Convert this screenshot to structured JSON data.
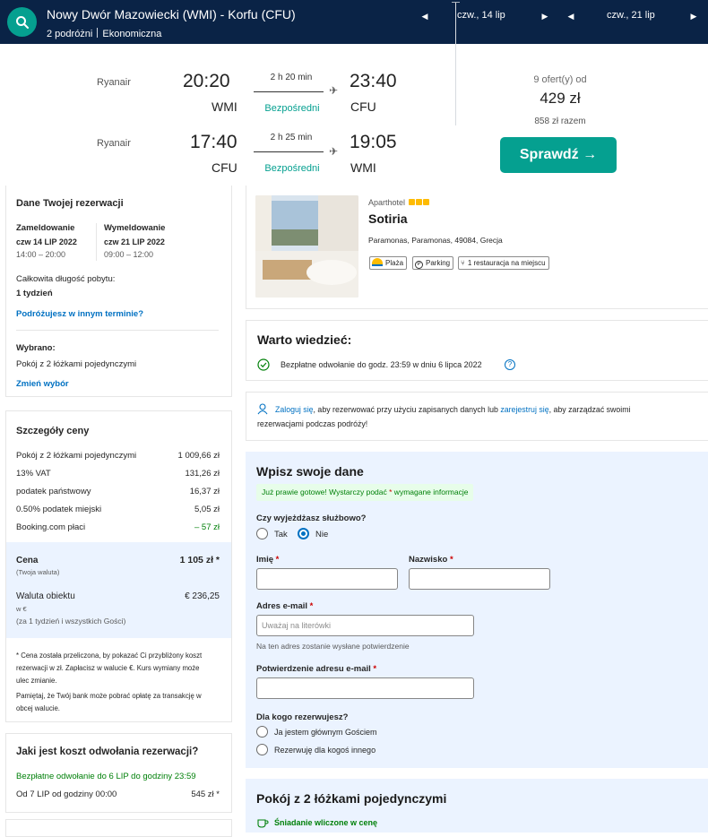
{
  "topbar": {
    "route": "Nowy Dwór Mazowiecki (WMI) - Korfu (CFU)",
    "travellers": "2 podróżni",
    "cabin": "Ekonomiczna",
    "depart_date": "czw., 14 lip",
    "return_date": "czw., 21 lip",
    "search_icon": "search-icon",
    "bg_color": "#0a2346",
    "accent": "#05a090"
  },
  "flight": {
    "outbound": {
      "airline": "Ryanair",
      "dep_time": "20:20",
      "dep_airport": "WMI",
      "duration": "2 h 20 min",
      "stops": "Bezpośredni",
      "arr_time": "23:40",
      "arr_airport": "CFU"
    },
    "inbound": {
      "airline": "Ryanair",
      "dep_time": "17:40",
      "dep_airport": "CFU",
      "duration": "2 h 25 min",
      "stops": "Bezpośredni",
      "arr_time": "19:05",
      "arr_airport": "WMI"
    },
    "offers": "9 ofert(y) od",
    "price": "429 zł",
    "price_total": "858 zł razem",
    "cta": "Sprawdź →"
  },
  "booking": {
    "title": "Dane Twojej rezerwacji",
    "checkin_label": "Zameldowanie",
    "checkin_date": "czw 14 LIP 2022",
    "checkin_time": "14:00 – 20:00",
    "checkout_label": "Wymeldowanie",
    "checkout_date": "czw 21 LIP 2022",
    "checkout_time": "09:00 – 12:00",
    "stay_label": "Całkowita długość pobytu:",
    "stay_value": "1 tydzień",
    "other_dates_link": "Podróżujesz w innym terminie?",
    "selected_label": "Wybrano:",
    "selected_value": "Pokój z 2 łóżkami pojedynczymi",
    "change_link": "Zmień wybór"
  },
  "price_details": {
    "title": "Szczegóły ceny",
    "rows": [
      {
        "label": "Pokój z 2 łóżkami pojedynczymi",
        "value": "1 009,66 zł"
      },
      {
        "label": "13% VAT",
        "value": "131,26 zł"
      },
      {
        "label": "podatek państwowy",
        "value": "16,37 zł"
      },
      {
        "label": "0.50% podatek miejski",
        "value": "5,05 zł"
      },
      {
        "label": "Booking.com płaci",
        "value": "– 57 zł"
      }
    ],
    "total_label": "Cena",
    "total_sub": "(Twoja waluta)",
    "total_value": "1 105 zł *",
    "property_currency_label": "Waluta obiektu",
    "property_currency_value": "€ 236,25",
    "property_currency_sub1": "w €",
    "property_currency_sub2": "(za 1 tydzień i wszystkich Gości)",
    "note1_line1": "* Cena została przeliczona, by pokazać Ci przybliżony koszt",
    "note1_line2": "rezerwacji w zł. Zapłacisz w walucie €. Kurs wymiany może",
    "note1_line3": "ulec zmianie.",
    "note2_line1": "Pamiętaj, że Twój bank może pobrać opłatę za transakcję w",
    "note2_line2": "obcej walucie."
  },
  "cancellation": {
    "title": "Jaki jest koszt odwołania rezerwacji?",
    "free_line": "Bezpłatne odwołanie do 6 LIP do godziny 23:59",
    "paid_label": "Od 7 LIP od godziny 00:00",
    "paid_value": "545 zł *"
  },
  "hotel": {
    "type": "Aparthotel",
    "name": "Sotiria",
    "address": "Paramonas, Paramonas, 49084, Grecja",
    "tags": [
      "Plaża",
      "Parking",
      "1 restauracja na miejscu"
    ]
  },
  "worth_knowing": {
    "title": "Warto wiedzieć:",
    "item": "Bezpłatne odwołanie do godz. 23:59 w dniu 6 lipca 2022"
  },
  "signin": {
    "link1": "Zaloguj się",
    "text1": ", aby rezerwować przy użyciu zapisanych danych lub ",
    "link2": "zarejestruj się",
    "text2": ", aby zarządzać swoimi",
    "line2": "rezerwacjami podczas podróży!"
  },
  "form": {
    "title": "Wpisz swoje dane",
    "notice_pre": "Już prawie gotowe! Wystarczy podać ",
    "notice_star": "*",
    "notice_post": " wymagane informacje",
    "business_q": "Czy wyjeżdżasz służbowo?",
    "yes": "Tak",
    "no": "Nie",
    "first_name": "Imię",
    "last_name": "Nazwisko",
    "email": "Adres e-mail",
    "email_placeholder": "Uważaj na literówki",
    "email_hint": "Na ten adres zostanie wysłane potwierdzenie",
    "email_confirm": "Potwierdzenie adresu e-mail",
    "for_whom": "Dla kogo rezerwujesz?",
    "opt_me": "Ja jestem głównym Gościem",
    "opt_other": "Rezerwuję dla kogoś innego",
    "star": "*"
  },
  "room": {
    "title": "Pokój z 2 łóżkami pojedynczymi",
    "breakfast": "Śniadanie wliczone w cenę"
  }
}
